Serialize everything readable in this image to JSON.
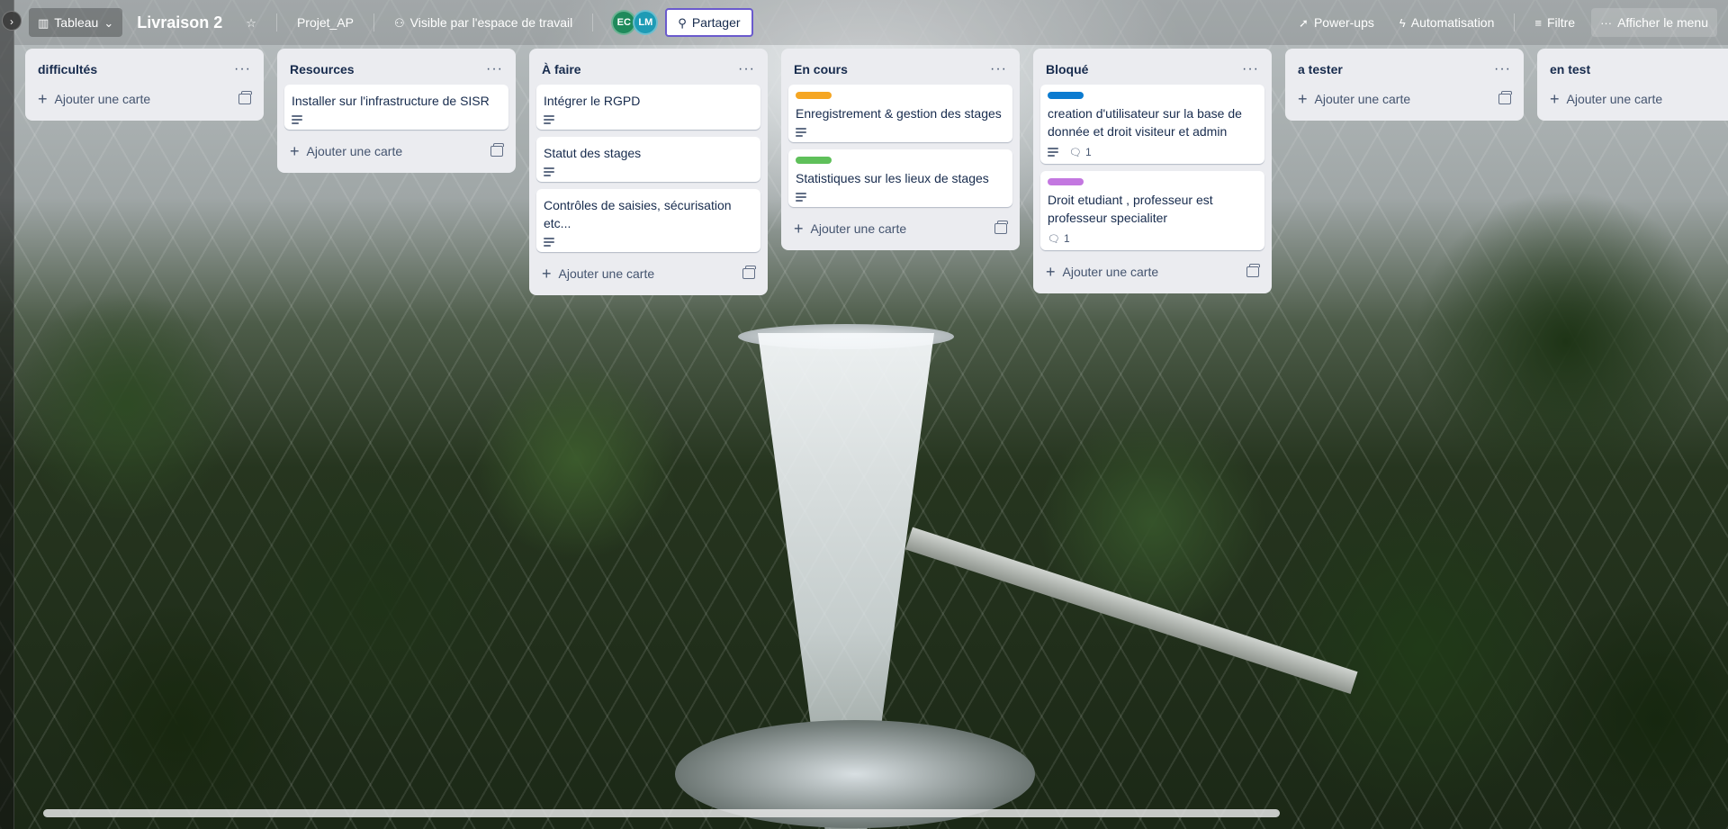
{
  "header": {
    "rail_toggle": "›",
    "view_icon": "board-view-icon",
    "view_label": "Tableau",
    "board_title": "Livraison 2",
    "workspace_label": "Projet_AP",
    "visibility_label": "Visible par l'espace de travail",
    "avatars": [
      {
        "initials": "EC",
        "color": "#1f8a5b"
      },
      {
        "initials": "LM",
        "color": "#1e9bb5"
      }
    ],
    "share_label": "Partager",
    "powerups_label": "Power-ups",
    "automation_label": "Automatisation",
    "filter_label": "Filtre",
    "menu_label": "Afficher le menu"
  },
  "add_card_label": "Ajouter une carte",
  "lists": [
    {
      "title": "difficultés",
      "cards": []
    },
    {
      "title": "Resources",
      "cards": [
        {
          "title": "Installer sur l'infrastructure de SISR",
          "has_description": true
        }
      ]
    },
    {
      "title": "À faire",
      "cards": [
        {
          "title": "Intégrer le RGPD",
          "has_description": true
        },
        {
          "title": "Statut des stages",
          "has_description": true
        },
        {
          "title": "Contrôles de saisies, sécurisation etc...",
          "has_description": true
        }
      ]
    },
    {
      "title": "En cours",
      "cards": [
        {
          "title": "Enregistrement & gestion des stages",
          "label_color": "#f5a623",
          "has_description": true
        },
        {
          "title": "Statistiques sur les lieux de stages",
          "label_color": "#5fc05a",
          "has_description": true
        }
      ]
    },
    {
      "title": "Bloqué",
      "cards": [
        {
          "title": "creation d'utilisateur sur la base de donnée et droit visiteur et admin",
          "label_color": "#0c7bd0",
          "has_description": true,
          "comments": "1"
        },
        {
          "title": "Droit etudiant , professeur est professeur specialiter",
          "label_color": "#c377e0",
          "has_description": false,
          "comments": "1"
        }
      ]
    },
    {
      "title": "a tester",
      "cards": []
    },
    {
      "title": "en test",
      "cards": []
    }
  ]
}
